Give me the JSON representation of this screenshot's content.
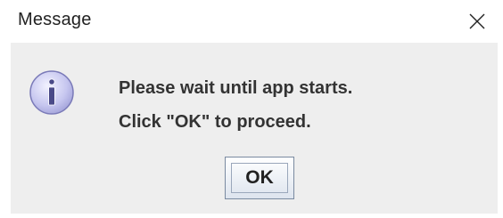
{
  "window": {
    "title": "Message",
    "close_icon": "close-icon"
  },
  "message": {
    "icon": "info-icon",
    "line1": "Please wait until app starts.",
    "line2": "Click \"OK\" to proceed."
  },
  "buttons": {
    "ok_label": "OK"
  },
  "colors": {
    "content_bg": "#eeeeee",
    "icon_fill": "#c8c8f0",
    "icon_stroke": "#7a7ab8"
  }
}
